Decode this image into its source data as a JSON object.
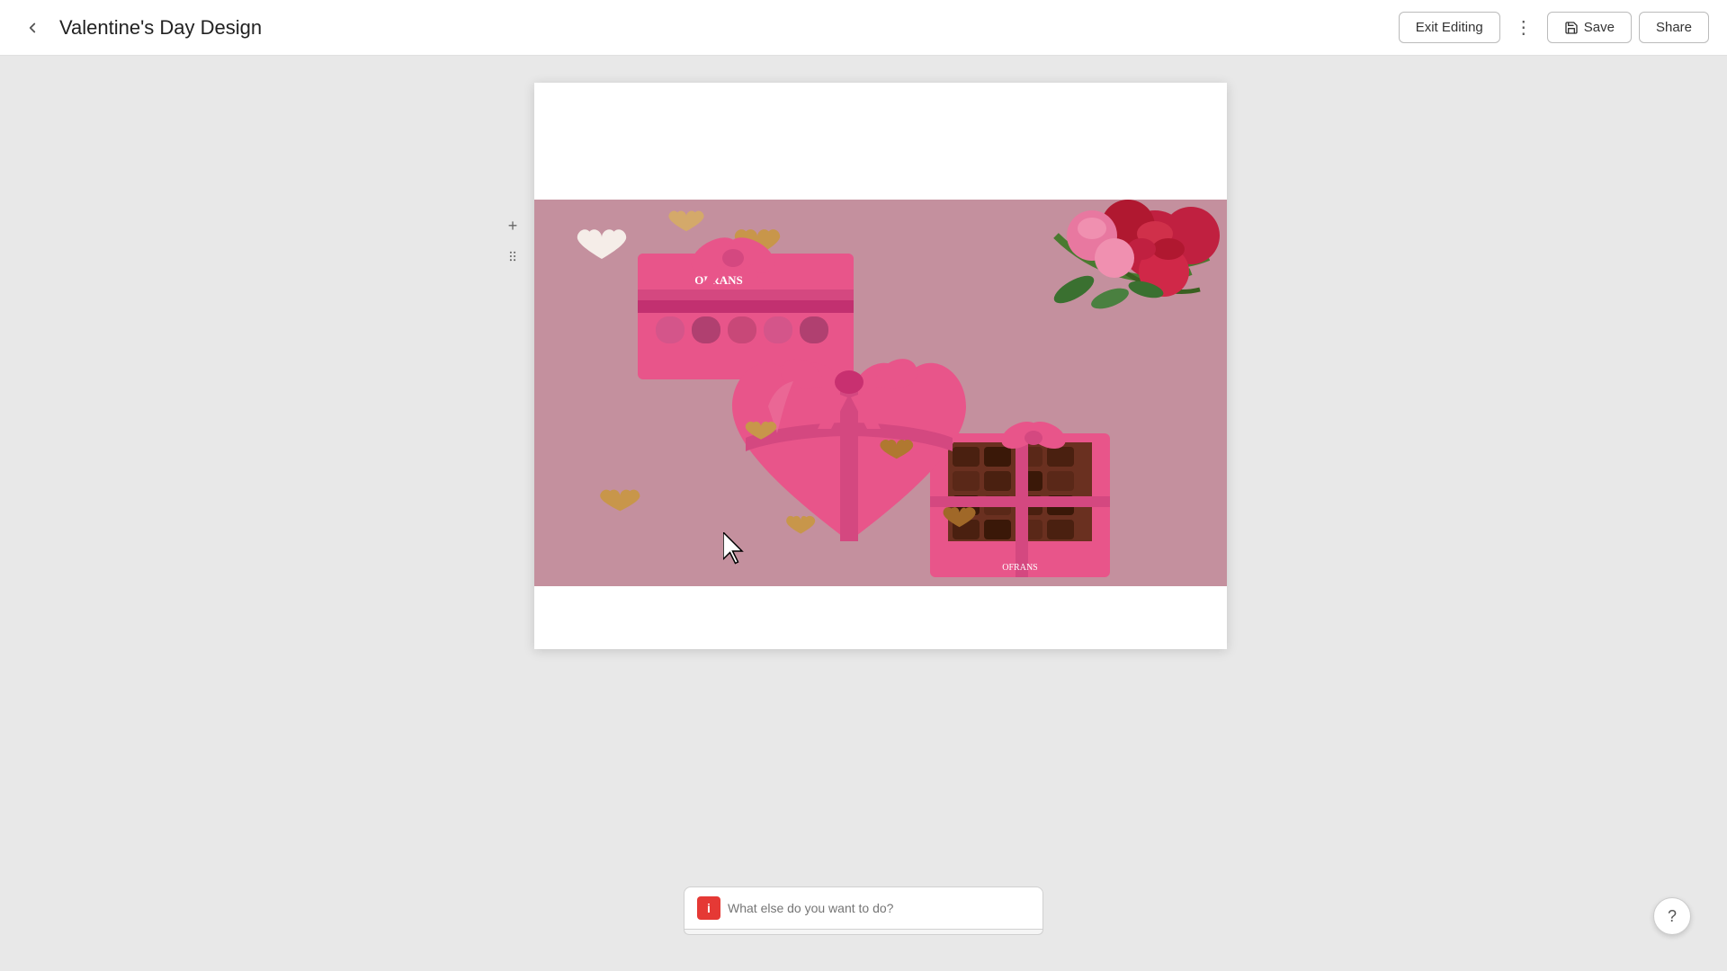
{
  "header": {
    "title": "Valentine's Day Design",
    "back_label": "←",
    "exit_editing_label": "Exit Editing",
    "more_label": "⋮",
    "save_label": "Save",
    "share_label": "Share"
  },
  "canvas": {
    "add_block_label": "+",
    "drag_block_label": "⠿"
  },
  "prompt": {
    "icon_label": "i",
    "placeholder": "What else do you want to do?"
  },
  "help": {
    "label": "?"
  },
  "colors": {
    "background": "#e8e8e8",
    "header_bg": "#ffffff",
    "canvas_bg": "#ffffff",
    "accent_red": "#e53935",
    "image_bg": "#c9a0b0"
  }
}
